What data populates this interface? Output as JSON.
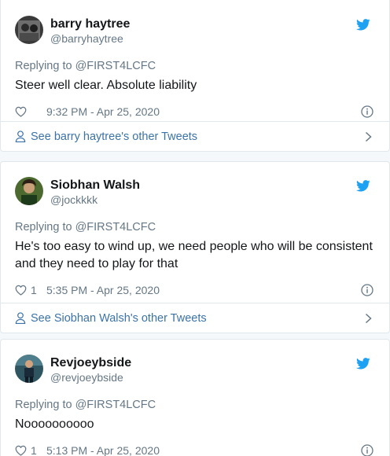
{
  "colors": {
    "twitter_blue": "#1da1f2",
    "link": "#3b73a8",
    "muted": "#657786",
    "text": "#14171a",
    "border": "#e1e8ed"
  },
  "tweets": [
    {
      "display_name": "barry haytree",
      "handle": "@barryhaytree",
      "replying_to": "Replying to @FIRST4LCFC",
      "text": "Steer well clear. Absolute liability",
      "likes": "",
      "timestamp": "9:32 PM - Apr 25, 2020",
      "see_other": "See barry haytree's other Tweets"
    },
    {
      "display_name": "Siobhan Walsh",
      "handle": "@jockkkk",
      "replying_to": "Replying to @FIRST4LCFC",
      "text": "He's too easy to wind up, we need people who will be consistent and they need to play for that",
      "likes": "1",
      "timestamp": "5:35 PM - Apr 25, 2020",
      "see_other": "See Siobhan Walsh's other Tweets"
    },
    {
      "display_name": "Revjoeybside",
      "handle": "@revjoeybside",
      "replying_to": "Replying to @FIRST4LCFC",
      "text": "Noooooooooo",
      "likes": "1",
      "timestamp": "5:13 PM - Apr 25, 2020"
    }
  ],
  "icons": {
    "brand": "twitter-bird-icon",
    "like": "heart-icon",
    "info": "info-icon",
    "profile": "person-icon",
    "more": "chevron-right-icon"
  }
}
